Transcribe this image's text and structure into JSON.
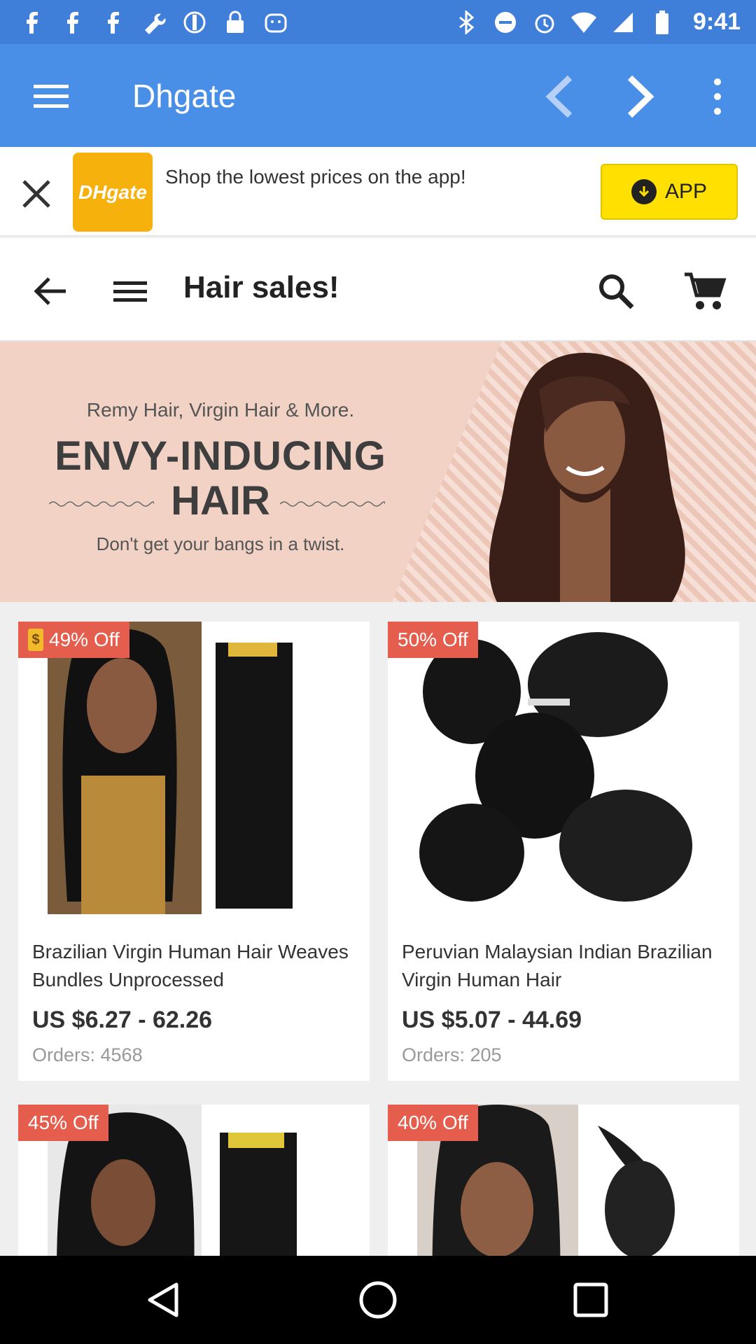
{
  "status_bar": {
    "time": "9:41",
    "left_icons": [
      "facebook-icon",
      "facebook-icon",
      "facebook-icon",
      "wrench-icon",
      "settings-icon",
      "lock-icon",
      "android-icon"
    ],
    "right_icons": [
      "bluetooth-icon",
      "do-not-disturb-icon",
      "alarm-icon",
      "wifi-icon",
      "signal-icon",
      "battery-icon"
    ]
  },
  "app_bar": {
    "title": "Dhgate",
    "menu_icon": "menu-icon",
    "back_icon": "chevron-left-icon",
    "forward_icon": "chevron-right-icon",
    "more_icon": "more-vert-icon",
    "bg_color": "#4a8fe7"
  },
  "app_banner": {
    "logo_text": "DHgate",
    "promo_text": "Shop the lowest prices on the app!",
    "button_label": "APP",
    "accent_color": "#ffe000"
  },
  "page_bar": {
    "title": "Hair sales!"
  },
  "hero": {
    "subtitle": "Remy Hair, Virgin Hair & More.",
    "headline_line1": "ENVY-INDUCING",
    "headline_line2": "HAIR",
    "tagline": "Don't get your bangs in a twist."
  },
  "products": [
    {
      "discount": "49% Off",
      "name": "Brazilian Virgin Human Hair Weaves Bundles Unprocessed",
      "price": "US $6.27 - 62.26",
      "orders": "Orders: 4568"
    },
    {
      "discount": "50% Off",
      "name": "Peruvian Malaysian Indian Brazilian Virgin Human Hair",
      "price": "US $5.07 - 44.69",
      "orders": "Orders: 205"
    },
    {
      "discount": "45% Off"
    },
    {
      "discount": "40% Off"
    }
  ]
}
